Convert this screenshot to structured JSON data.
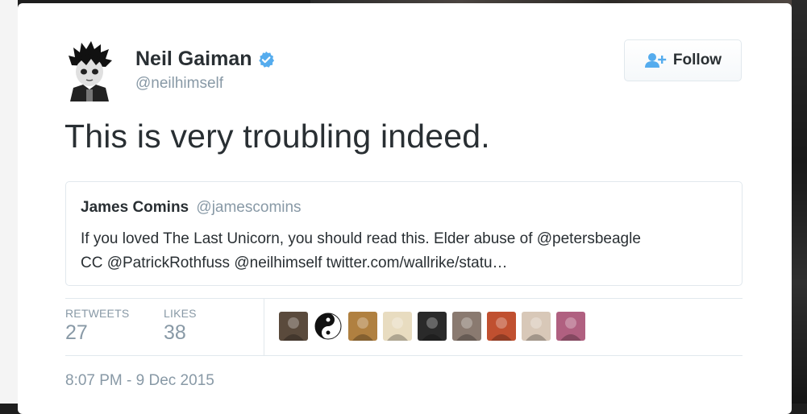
{
  "tweet": {
    "author": {
      "name": "Neil Gaiman",
      "handle": "@neilhimself",
      "verified": true,
      "avatar_icon": "cartoon-avatar-icon"
    },
    "follow_button": {
      "label": "Follow",
      "icon": "add-user-icon"
    },
    "text": "This is very troubling indeed.",
    "quoted_tweet": {
      "author_name": "James Comins",
      "author_handle": "@jamescomins",
      "text_line1": "If you loved The Last Unicorn, you should read this. Elder abuse of @petersbeagle",
      "text_line2": "CC @PatrickRothfuss @neilhimself  twitter.com/wallrike/statu…"
    },
    "stats": {
      "retweets_label": "RETWEETS",
      "retweets_value": "27",
      "likes_label": "LIKES",
      "likes_value": "38"
    },
    "liker_avatars": [
      {
        "icon": "liker-avatar-icon",
        "color": "#5a4a3c"
      },
      {
        "icon": "yin-yang-avatar-icon",
        "color": "#1a1a1a"
      },
      {
        "icon": "liker-avatar-icon",
        "color": "#b08040"
      },
      {
        "icon": "liker-avatar-icon",
        "color": "#e8dcc0"
      },
      {
        "icon": "liker-avatar-icon",
        "color": "#2a2a2a"
      },
      {
        "icon": "liker-avatar-icon",
        "color": "#8a7a70"
      },
      {
        "icon": "liker-avatar-icon",
        "color": "#c05030"
      },
      {
        "icon": "liker-avatar-icon",
        "color": "#d8c8b8"
      },
      {
        "icon": "liker-avatar-icon",
        "color": "#b06080"
      }
    ],
    "timestamp": "8:07 PM - 9 Dec 2015"
  },
  "colors": {
    "text_primary": "#292f33",
    "text_secondary": "#8899a6",
    "verified_blue": "#55acee",
    "border": "#e1e8ed"
  }
}
